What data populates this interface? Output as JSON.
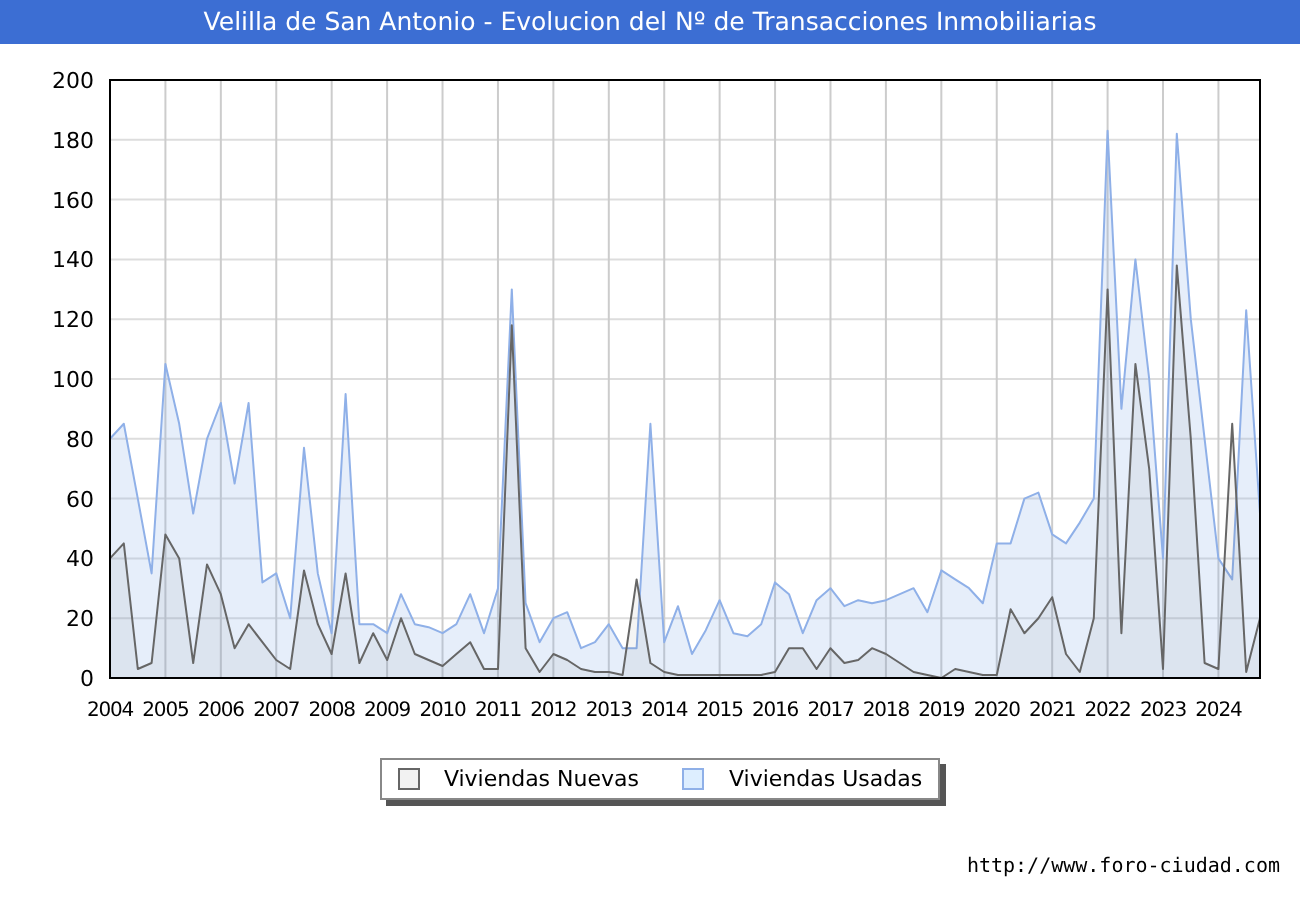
{
  "title": "Velilla de San Antonio - Evolucion del Nº de Transacciones Inmobiliarias",
  "chart": {
    "chart_data": {
      "type": "area",
      "grid": true,
      "xlim": [
        2004,
        2024.75
      ],
      "ylim": [
        0,
        200
      ],
      "yticks": [
        0,
        20,
        40,
        60,
        80,
        100,
        120,
        140,
        160,
        180,
        200
      ],
      "xticks": [
        2004,
        2005,
        2006,
        2007,
        2008,
        2009,
        2010,
        2011,
        2012,
        2013,
        2014,
        2015,
        2016,
        2017,
        2018,
        2019,
        2020,
        2021,
        2022,
        2023,
        2024
      ],
      "x": [
        2004,
        2004.25,
        2004.5,
        2004.75,
        2005,
        2005.25,
        2005.5,
        2005.75,
        2006,
        2006.25,
        2006.5,
        2006.75,
        2007,
        2007.25,
        2007.5,
        2007.75,
        2008,
        2008.25,
        2008.5,
        2008.75,
        2009,
        2009.25,
        2009.5,
        2009.75,
        2010,
        2010.25,
        2010.5,
        2010.75,
        2011,
        2011.25,
        2011.5,
        2011.75,
        2012,
        2012.25,
        2012.5,
        2012.75,
        2013,
        2013.25,
        2013.5,
        2013.75,
        2014,
        2014.25,
        2014.5,
        2014.75,
        2015,
        2015.25,
        2015.5,
        2015.75,
        2016,
        2016.25,
        2016.5,
        2016.75,
        2017,
        2017.25,
        2017.5,
        2017.75,
        2018,
        2018.25,
        2018.5,
        2018.75,
        2019,
        2019.25,
        2019.5,
        2019.75,
        2020,
        2020.25,
        2020.5,
        2020.75,
        2021,
        2021.25,
        2021.5,
        2021.75,
        2022,
        2022.25,
        2022.5,
        2022.75,
        2023,
        2023.25,
        2023.5,
        2023.75,
        2024,
        2024.25,
        2024.5,
        2024.75
      ],
      "series": [
        {
          "name": "Viviendas Nuevas",
          "color": "#666666",
          "values": [
            40,
            45,
            3,
            5,
            48,
            40,
            5,
            38,
            28,
            10,
            18,
            12,
            6,
            3,
            36,
            18,
            8,
            35,
            5,
            15,
            6,
            20,
            8,
            6,
            4,
            8,
            12,
            3,
            3,
            118,
            10,
            2,
            8,
            6,
            3,
            2,
            2,
            1,
            33,
            5,
            2,
            1,
            1,
            1,
            1,
            1,
            1,
            1,
            2,
            10,
            10,
            3,
            10,
            5,
            6,
            10,
            8,
            5,
            2,
            1,
            0,
            3,
            2,
            1,
            1,
            23,
            15,
            20,
            27,
            8,
            2,
            20,
            130,
            15,
            105,
            70,
            3,
            138,
            80,
            5,
            3,
            85,
            2,
            20
          ]
        },
        {
          "name": "Viviendas Usadas",
          "color": "#8fb0e8",
          "values": [
            80,
            85,
            60,
            35,
            105,
            85,
            55,
            80,
            92,
            65,
            92,
            32,
            35,
            20,
            77,
            35,
            15,
            95,
            18,
            18,
            15,
            28,
            18,
            17,
            15,
            18,
            28,
            15,
            30,
            130,
            25,
            12,
            20,
            22,
            10,
            12,
            18,
            10,
            10,
            85,
            12,
            24,
            8,
            16,
            26,
            15,
            14,
            18,
            32,
            28,
            15,
            26,
            30,
            24,
            26,
            25,
            26,
            28,
            30,
            22,
            36,
            33,
            30,
            25,
            45,
            45,
            60,
            62,
            48,
            45,
            52,
            60,
            183,
            90,
            140,
            100,
            40,
            182,
            120,
            80,
            40,
            33,
            123,
            55
          ]
        }
      ]
    }
  },
  "url": "http://www.foro-ciudad.com"
}
